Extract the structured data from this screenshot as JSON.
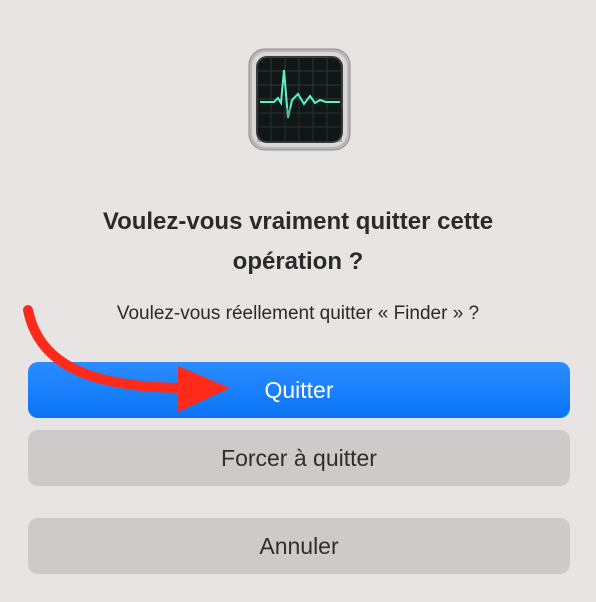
{
  "dialog": {
    "icon": "activity-monitor-icon",
    "title_line1": "Voulez-vous vraiment quitter cette",
    "title_line2": "opération ?",
    "message": "Voulez-vous réellement quitter « Finder » ?"
  },
  "buttons": {
    "quit_label": "Quitter",
    "force_quit_label": "Forcer à quitter",
    "cancel_label": "Annuler"
  },
  "annotation": {
    "arrow_icon": "red-arrow-icon",
    "arrow_color": "#ff2a1a"
  },
  "colors": {
    "primary": "#0a74f6",
    "secondary": "#cfcaca",
    "background": "#e8e4e4"
  }
}
